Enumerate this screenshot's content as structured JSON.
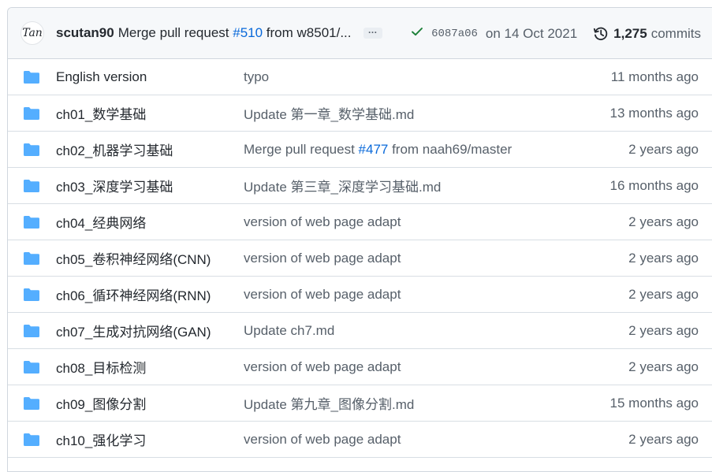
{
  "latest_commit": {
    "avatar_text": "Tan",
    "author": "scutan90",
    "message_prefix": "Merge pull request ",
    "message_pr": "#510",
    "message_suffix": " from w8501/...",
    "ellipsis": "…",
    "sha": "6087a06",
    "date": "on 14 Oct 2021",
    "commits_count": "1,275",
    "commits_label": "commits"
  },
  "colors": {
    "folder": "#54aeff",
    "link": "#0969da",
    "success": "#1a7f37"
  },
  "files": [
    {
      "name": "English version",
      "msg_prefix": "typo",
      "msg_pr": "",
      "msg_suffix": "",
      "age": "11 months ago"
    },
    {
      "name": "ch01_数学基础",
      "msg_prefix": "Update 第一章_数学基础.md",
      "msg_pr": "",
      "msg_suffix": "",
      "age": "13 months ago"
    },
    {
      "name": "ch02_机器学习基础",
      "msg_prefix": "Merge pull request ",
      "msg_pr": "#477",
      "msg_suffix": " from naah69/master",
      "age": "2 years ago"
    },
    {
      "name": "ch03_深度学习基础",
      "msg_prefix": "Update 第三章_深度学习基础.md",
      "msg_pr": "",
      "msg_suffix": "",
      "age": "16 months ago"
    },
    {
      "name": "ch04_经典网络",
      "msg_prefix": "version of web page adapt",
      "msg_pr": "",
      "msg_suffix": "",
      "age": "2 years ago"
    },
    {
      "name": "ch05_卷积神经网络(CNN)",
      "msg_prefix": "version of web page adapt",
      "msg_pr": "",
      "msg_suffix": "",
      "age": "2 years ago"
    },
    {
      "name": "ch06_循环神经网络(RNN)",
      "msg_prefix": "version of web page adapt",
      "msg_pr": "",
      "msg_suffix": "",
      "age": "2 years ago"
    },
    {
      "name": "ch07_生成对抗网络(GAN)",
      "msg_prefix": "Update ch7.md",
      "msg_pr": "",
      "msg_suffix": "",
      "age": "2 years ago"
    },
    {
      "name": "ch08_目标检测",
      "msg_prefix": "version of web page adapt",
      "msg_pr": "",
      "msg_suffix": "",
      "age": "2 years ago"
    },
    {
      "name": "ch09_图像分割",
      "msg_prefix": "Update 第九章_图像分割.md",
      "msg_pr": "",
      "msg_suffix": "",
      "age": "15 months ago"
    },
    {
      "name": "ch10_强化学习",
      "msg_prefix": "version of web page adapt",
      "msg_pr": "",
      "msg_suffix": "",
      "age": "2 years ago"
    }
  ]
}
